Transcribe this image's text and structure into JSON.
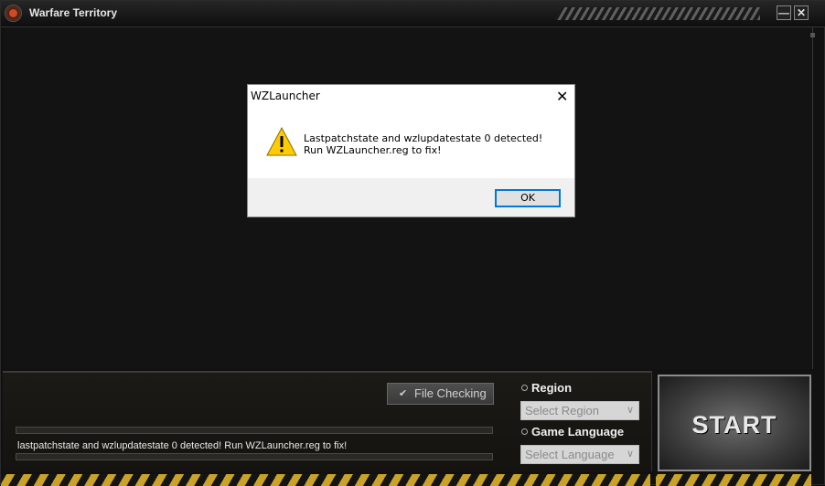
{
  "window": {
    "title": "Warfare Territory",
    "minimize_glyph": "—",
    "close_glyph": "✕"
  },
  "launcher": {
    "file_check_label": "File Checking",
    "status_message": "lastpatchstate and wzlupdatestate 0 detected! Run WZLauncher.reg to fix!",
    "region": {
      "label": "Region",
      "placeholder": "Select Region"
    },
    "language": {
      "label": "Game Language",
      "placeholder": "Select Language"
    },
    "start_label": "START"
  },
  "dialog": {
    "title": "WZLauncher",
    "message": "Lastpatchstate and wzlupdatestate 0 detected! Run WZLauncher.reg to fix!",
    "ok_label": "OK",
    "close_glyph": "✕"
  },
  "colors": {
    "hazard_yellow": "#c9a227",
    "focus_blue": "#0078d7",
    "warning_yellow": "#ffcc00"
  },
  "icons": [
    "app-logo-icon",
    "check-icon",
    "chevron-down-icon",
    "warning-icon",
    "close-icon"
  ]
}
